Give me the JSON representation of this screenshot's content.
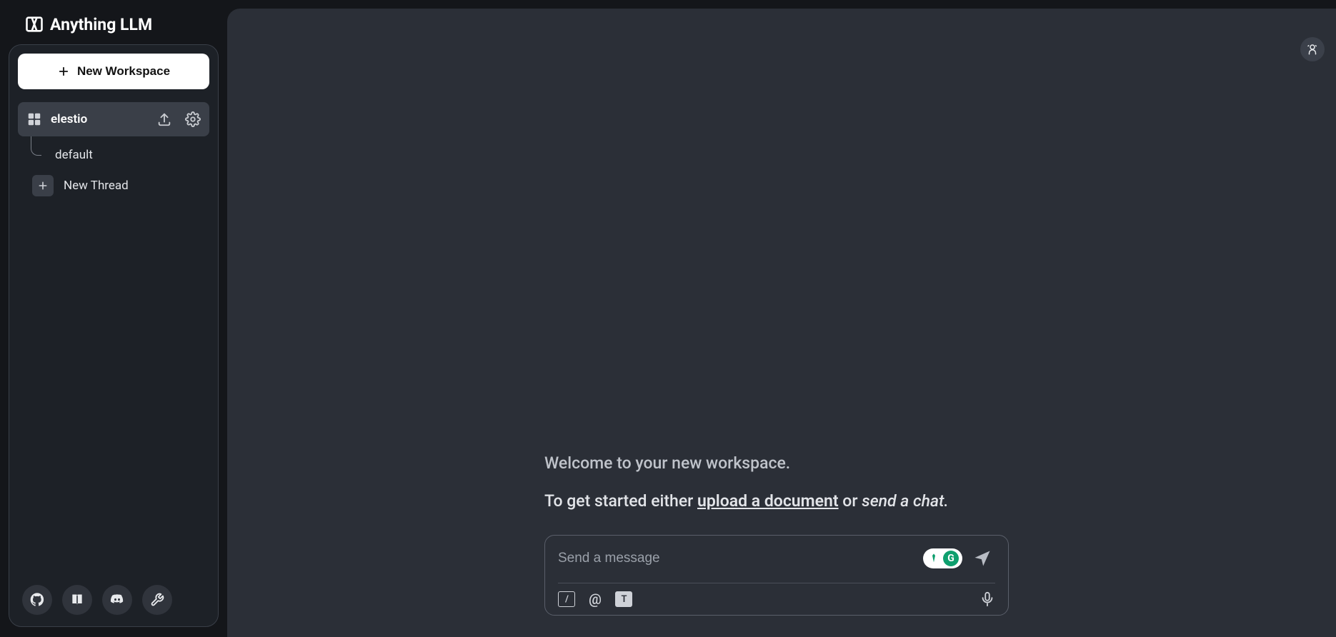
{
  "brand": {
    "title": "Anything LLM"
  },
  "sidebar": {
    "new_workspace_label": "New Workspace",
    "workspace": {
      "name": "elestio"
    },
    "threads": {
      "default_label": "default",
      "new_thread_label": "New Thread"
    }
  },
  "main": {
    "welcome_line1": "Welcome to your new workspace.",
    "welcome_prefix": "To get started either ",
    "welcome_link": "upload a document",
    "welcome_or": " or ",
    "welcome_em": "send a chat.",
    "composer": {
      "placeholder": "Send a message",
      "slash_label": "/",
      "at_label": "@",
      "text_label": "T",
      "badge2": "G"
    }
  }
}
